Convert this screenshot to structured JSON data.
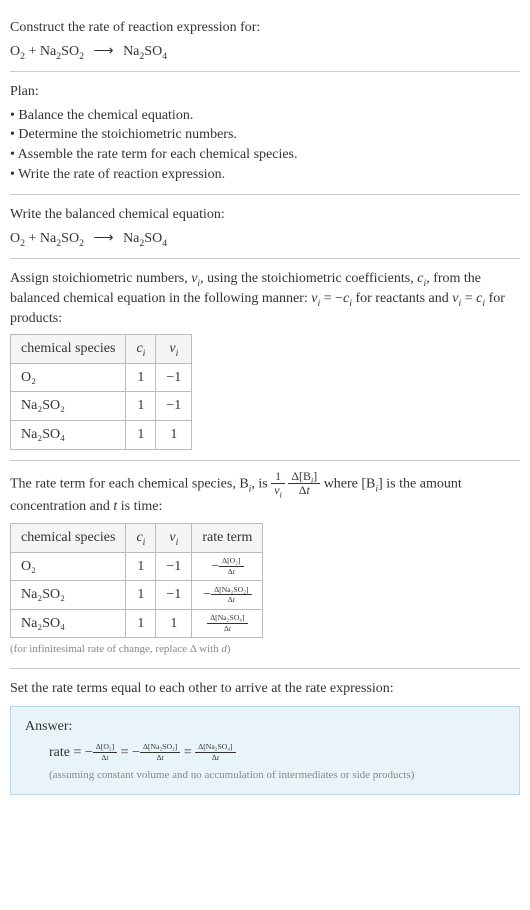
{
  "title": "Construct the rate of reaction expression for:",
  "eq_unbalanced": {
    "lhs_a": "O",
    "lhs_a_sub": "2",
    "plus1": " + Na",
    "lhs_b_sub": "2",
    "lhs_b_cont": "SO",
    "lhs_b_sub2": "2",
    "arrow": "⟶",
    "rhs": "Na",
    "rhs_sub1": "2",
    "rhs_cont": "SO",
    "rhs_sub2": "4"
  },
  "plan": {
    "heading": "Plan:",
    "items": [
      "• Balance the chemical equation.",
      "• Determine the stoichiometric numbers.",
      "• Assemble the rate term for each chemical species.",
      "• Write the rate of reaction expression."
    ]
  },
  "balanced_heading": "Write the balanced chemical equation:",
  "stoich_text_a": "Assign stoichiometric numbers, ",
  "stoich_nu": "ν",
  "stoich_i": "i",
  "stoich_text_b": ", using the stoichiometric coefficients, ",
  "stoich_c": "c",
  "stoich_text_c": ", from the balanced chemical equation in the following manner: ",
  "stoich_eq1": " = −",
  "stoich_text_d": " for reactants and ",
  "stoich_eq2": " = ",
  "stoich_text_e": " for products:",
  "table1": {
    "headers": [
      "chemical species",
      "cᵢ",
      "νᵢ"
    ],
    "rows": [
      {
        "species": "O₂",
        "c": "1",
        "nu": "−1"
      },
      {
        "species": "Na₂SO₂",
        "c": "1",
        "nu": "−1"
      },
      {
        "species": "Na₂SO₄",
        "c": "1",
        "nu": "1"
      }
    ]
  },
  "rate_term_text_a": "The rate term for each chemical species, B",
  "rate_term_text_b": ", is ",
  "rate_term_text_c": " where [B",
  "rate_term_text_d": "] is the amount concentration and ",
  "rate_term_t": "t",
  "rate_term_text_e": " is time:",
  "frac1_num": "1",
  "frac1_den_nu": "ν",
  "frac2_num": "Δ[Bᵢ]",
  "frac2_den": "Δt",
  "table2": {
    "headers": [
      "chemical species",
      "cᵢ",
      "νᵢ",
      "rate term"
    ],
    "rows": [
      {
        "species": "O₂",
        "c": "1",
        "nu": "−1",
        "rt_num": "Δ[O₂]",
        "rt_den": "Δt",
        "neg": "−"
      },
      {
        "species": "Na₂SO₂",
        "c": "1",
        "nu": "−1",
        "rt_num": "Δ[Na₂SO₂]",
        "rt_den": "Δt",
        "neg": "−"
      },
      {
        "species": "Na₂SO₄",
        "c": "1",
        "nu": "1",
        "rt_num": "Δ[Na₂SO₄]",
        "rt_den": "Δt",
        "neg": ""
      }
    ]
  },
  "infinitesimal_note": "(for infinitesimal rate of change, replace Δ with d)",
  "set_equal_text": "Set the rate terms equal to each other to arrive at the rate expression:",
  "answer": {
    "title": "Answer:",
    "rate_label": "rate = ",
    "neg": "−",
    "term1_num": "Δ[O₂]",
    "term1_den": "Δt",
    "eq": " = ",
    "term2_num": "Δ[Na₂SO₂]",
    "term2_den": "Δt",
    "term3_num": "Δ[Na₂SO₄]",
    "term3_den": "Δt",
    "note": "(assuming constant volume and no accumulation of intermediates or side products)"
  },
  "raw_species": {
    "O2": "O₂",
    "Na2SO2": "Na₂SO₂",
    "Na2SO4": "Na₂SO₄"
  }
}
